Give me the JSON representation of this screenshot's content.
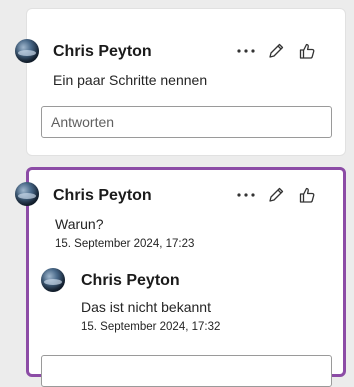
{
  "thread1": {
    "author": "Chris Peyton",
    "text": "Ein paar Schritte nennen",
    "reply_placeholder": "Antworten"
  },
  "thread2": {
    "author": "Chris Peyton",
    "text": "Warun?",
    "timestamp": "15. September 2024, 17:23",
    "reply": {
      "author": "Chris Peyton",
      "text": "Das ist nicht bekannt",
      "timestamp": "15. September 2024, 17:32"
    }
  },
  "colors": {
    "active_border": "#8c4ca6"
  },
  "icons": [
    "more-options-icon",
    "edit-pencil-icon",
    "thumbs-up-icon"
  ]
}
